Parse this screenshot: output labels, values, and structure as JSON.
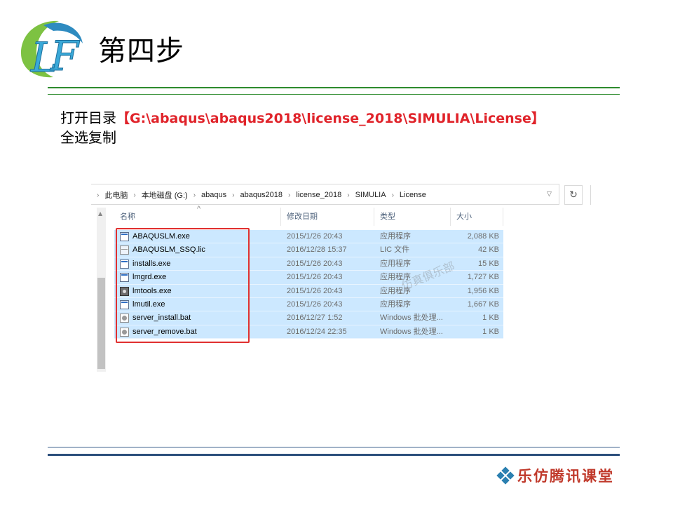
{
  "slide": {
    "title": "第四步",
    "instruction_prefix": "打开目录",
    "instruction_path": "【G:\\abaqus\\abaqus2018\\license_2018\\SIMULIA\\License】",
    "instruction_line2": "全选复制",
    "footer_brand": "乐仿腾讯课堂"
  },
  "explorer": {
    "breadcrumbs": [
      "此电脑",
      "本地磁盘 (G:)",
      "abaqus",
      "abaqus2018",
      "license_2018",
      "SIMULIA",
      "License"
    ],
    "columns": [
      "名称",
      "修改日期",
      "类型",
      "大小"
    ],
    "files": [
      {
        "name": "ABAQUSLM.exe",
        "date": "2015/1/26 20:43",
        "type": "应用程序",
        "size": "2,088 KB",
        "icon": "exe-icon"
      },
      {
        "name": "ABAQUSLM_SSQ.lic",
        "date": "2016/12/28 15:37",
        "type": "LIC 文件",
        "size": "42 KB",
        "icon": "lic-file-icon"
      },
      {
        "name": "installs.exe",
        "date": "2015/1/26 20:43",
        "type": "应用程序",
        "size": "15 KB",
        "icon": "exe-icon"
      },
      {
        "name": "lmgrd.exe",
        "date": "2015/1/26 20:43",
        "type": "应用程序",
        "size": "1,727 KB",
        "icon": "exe-icon"
      },
      {
        "name": "lmtools.exe",
        "date": "2015/1/26 20:43",
        "type": "应用程序",
        "size": "1,956 KB",
        "icon": "lmtools-icon"
      },
      {
        "name": "lmutil.exe",
        "date": "2015/1/26 20:43",
        "type": "应用程序",
        "size": "1,667 KB",
        "icon": "exe-icon"
      },
      {
        "name": "server_install.bat",
        "date": "2016/12/27 1:52",
        "type": "Windows 批处理...",
        "size": "1 KB",
        "icon": "bat-file-icon"
      },
      {
        "name": "server_remove.bat",
        "date": "2016/12/24 22:35",
        "type": "Windows 批处理...",
        "size": "1 KB",
        "icon": "bat-file-icon"
      }
    ],
    "watermark": "仿真俱乐部"
  },
  "colors": {
    "selection": "#cce8ff",
    "highlight_frame": "#e03030",
    "path_text": "#e0232a",
    "rule_green": "#2e8b2e",
    "rule_blue": "#2c4f7c"
  }
}
